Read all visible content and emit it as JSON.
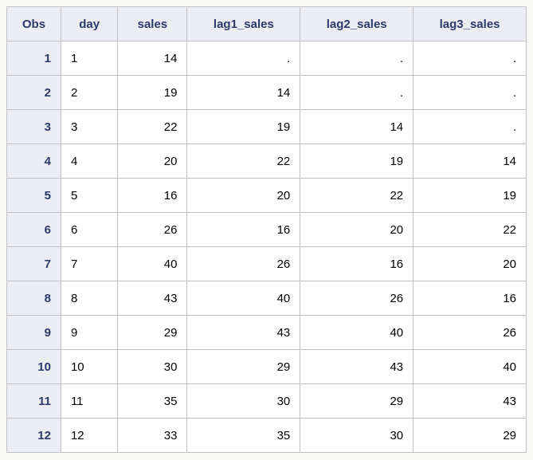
{
  "columns": {
    "obs": "Obs",
    "day": "day",
    "sales": "sales",
    "lag1": "lag1_sales",
    "lag2": "lag2_sales",
    "lag3": "lag3_sales"
  },
  "rows": [
    {
      "obs": "1",
      "day": "1",
      "sales": "14",
      "lag1": ".",
      "lag2": ".",
      "lag3": "."
    },
    {
      "obs": "2",
      "day": "2",
      "sales": "19",
      "lag1": "14",
      "lag2": ".",
      "lag3": "."
    },
    {
      "obs": "3",
      "day": "3",
      "sales": "22",
      "lag1": "19",
      "lag2": "14",
      "lag3": "."
    },
    {
      "obs": "4",
      "day": "4",
      "sales": "20",
      "lag1": "22",
      "lag2": "19",
      "lag3": "14"
    },
    {
      "obs": "5",
      "day": "5",
      "sales": "16",
      "lag1": "20",
      "lag2": "22",
      "lag3": "19"
    },
    {
      "obs": "6",
      "day": "6",
      "sales": "26",
      "lag1": "16",
      "lag2": "20",
      "lag3": "22"
    },
    {
      "obs": "7",
      "day": "7",
      "sales": "40",
      "lag1": "26",
      "lag2": "16",
      "lag3": "20"
    },
    {
      "obs": "8",
      "day": "8",
      "sales": "43",
      "lag1": "40",
      "lag2": "26",
      "lag3": "16"
    },
    {
      "obs": "9",
      "day": "9",
      "sales": "29",
      "lag1": "43",
      "lag2": "40",
      "lag3": "26"
    },
    {
      "obs": "10",
      "day": "10",
      "sales": "30",
      "lag1": "29",
      "lag2": "43",
      "lag3": "40"
    },
    {
      "obs": "11",
      "day": "11",
      "sales": "35",
      "lag1": "30",
      "lag2": "29",
      "lag3": "43"
    },
    {
      "obs": "12",
      "day": "12",
      "sales": "33",
      "lag1": "35",
      "lag2": "30",
      "lag3": "29"
    }
  ],
  "chart_data": {
    "type": "table",
    "title": "",
    "columns": [
      "Obs",
      "day",
      "sales",
      "lag1_sales",
      "lag2_sales",
      "lag3_sales"
    ],
    "data": [
      [
        1,
        1,
        14,
        null,
        null,
        null
      ],
      [
        2,
        2,
        19,
        14,
        null,
        null
      ],
      [
        3,
        3,
        22,
        19,
        14,
        null
      ],
      [
        4,
        4,
        20,
        22,
        19,
        14
      ],
      [
        5,
        5,
        16,
        20,
        22,
        19
      ],
      [
        6,
        6,
        26,
        16,
        20,
        22
      ],
      [
        7,
        7,
        40,
        26,
        16,
        20
      ],
      [
        8,
        8,
        43,
        40,
        26,
        16
      ],
      [
        9,
        9,
        29,
        43,
        40,
        26
      ],
      [
        10,
        10,
        30,
        29,
        43,
        40
      ],
      [
        11,
        11,
        35,
        30,
        29,
        43
      ],
      [
        12,
        12,
        33,
        35,
        30,
        29
      ]
    ]
  }
}
